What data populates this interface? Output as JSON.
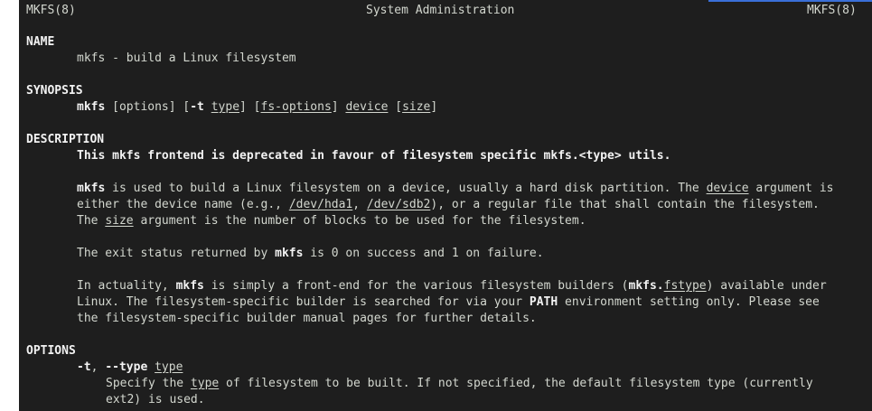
{
  "header": {
    "left": "MKFS(8)",
    "center": "System Administration",
    "right": "MKFS(8)"
  },
  "colors": {
    "background": "#1e1e1e",
    "text": "#d3d7cf",
    "bold": "#f2f2f2",
    "accent": "#3a6fd8"
  },
  "name": {
    "heading": "NAME",
    "line": "mkfs - build a Linux filesystem"
  },
  "synopsis": {
    "heading": "SYNOPSIS",
    "cmd": "mkfs",
    "s1": " [options] [",
    "opt_t": "-t",
    "s2": " ",
    "type": "type",
    "s3": "] [",
    "fs_options": "fs-options",
    "s4": "] ",
    "device": "device",
    "s5": " [",
    "size": "size",
    "s6": "]"
  },
  "description": {
    "heading": "DESCRIPTION",
    "deprecated": "This mkfs frontend is deprecated in favour of filesystem specific mkfs.<type> utils.",
    "p1": {
      "l1_cmd": "mkfs",
      "l1_text": " is used to build a Linux filesystem on a device, usually a hard disk partition. The ",
      "l1_device": "device",
      "l1_end": " argument is",
      "l2_a": "either the device name (e.g., ",
      "l2_hda1": "/dev/hda1",
      "l2_b": ", ",
      "l2_sdb2": "/dev/sdb2",
      "l2_c": "), or a regular file that shall contain the filesystem.",
      "l3_a": "The ",
      "l3_size": "size",
      "l3_b": " argument is the number of blocks to be used for the filesystem."
    },
    "p2": {
      "a": "The exit status returned by ",
      "cmd": "mkfs",
      "b": " is 0 on success and 1 on failure."
    },
    "p3": {
      "l1_a": "In actuality, ",
      "l1_cmd": "mkfs",
      "l1_b": " is simply a front-end for the various filesystem builders (",
      "l1_mkfs_dot": "mkfs.",
      "l1_fstype": "fstype",
      "l1_c": ") available under",
      "l2_a": "Linux. The filesystem-specific builder is searched for via your ",
      "l2_path": "PATH",
      "l2_b": " environment setting only. Please see",
      "l3": "the filesystem-specific builder manual pages for further details."
    }
  },
  "options": {
    "heading": "OPTIONS",
    "t_short": "-t",
    "t_sep": ", ",
    "t_long": "--type",
    "t_sp": " ",
    "t_arg": "type",
    "desc_l1_a": "Specify the ",
    "desc_l1_type": "type",
    "desc_l1_b": " of filesystem to be built. If not specified, the default filesystem type (currently",
    "desc_l2": "ext2) is used."
  }
}
